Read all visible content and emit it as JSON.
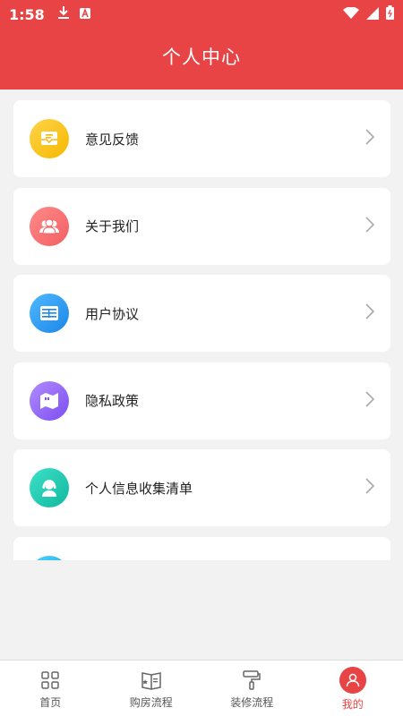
{
  "status_bar": {
    "time": "1:58"
  },
  "header": {
    "title": "个人中心"
  },
  "menu": {
    "items": [
      {
        "label": "意见反馈"
      },
      {
        "label": "关于我们"
      },
      {
        "label": "用户协议"
      },
      {
        "label": "隐私政策"
      },
      {
        "label": "个人信息收集清单"
      }
    ]
  },
  "tabbar": {
    "tabs": [
      {
        "label": "首页"
      },
      {
        "label": "购房流程"
      },
      {
        "label": "装修流程"
      },
      {
        "label": "我的"
      }
    ]
  },
  "colors": {
    "accent": "#e84345"
  }
}
